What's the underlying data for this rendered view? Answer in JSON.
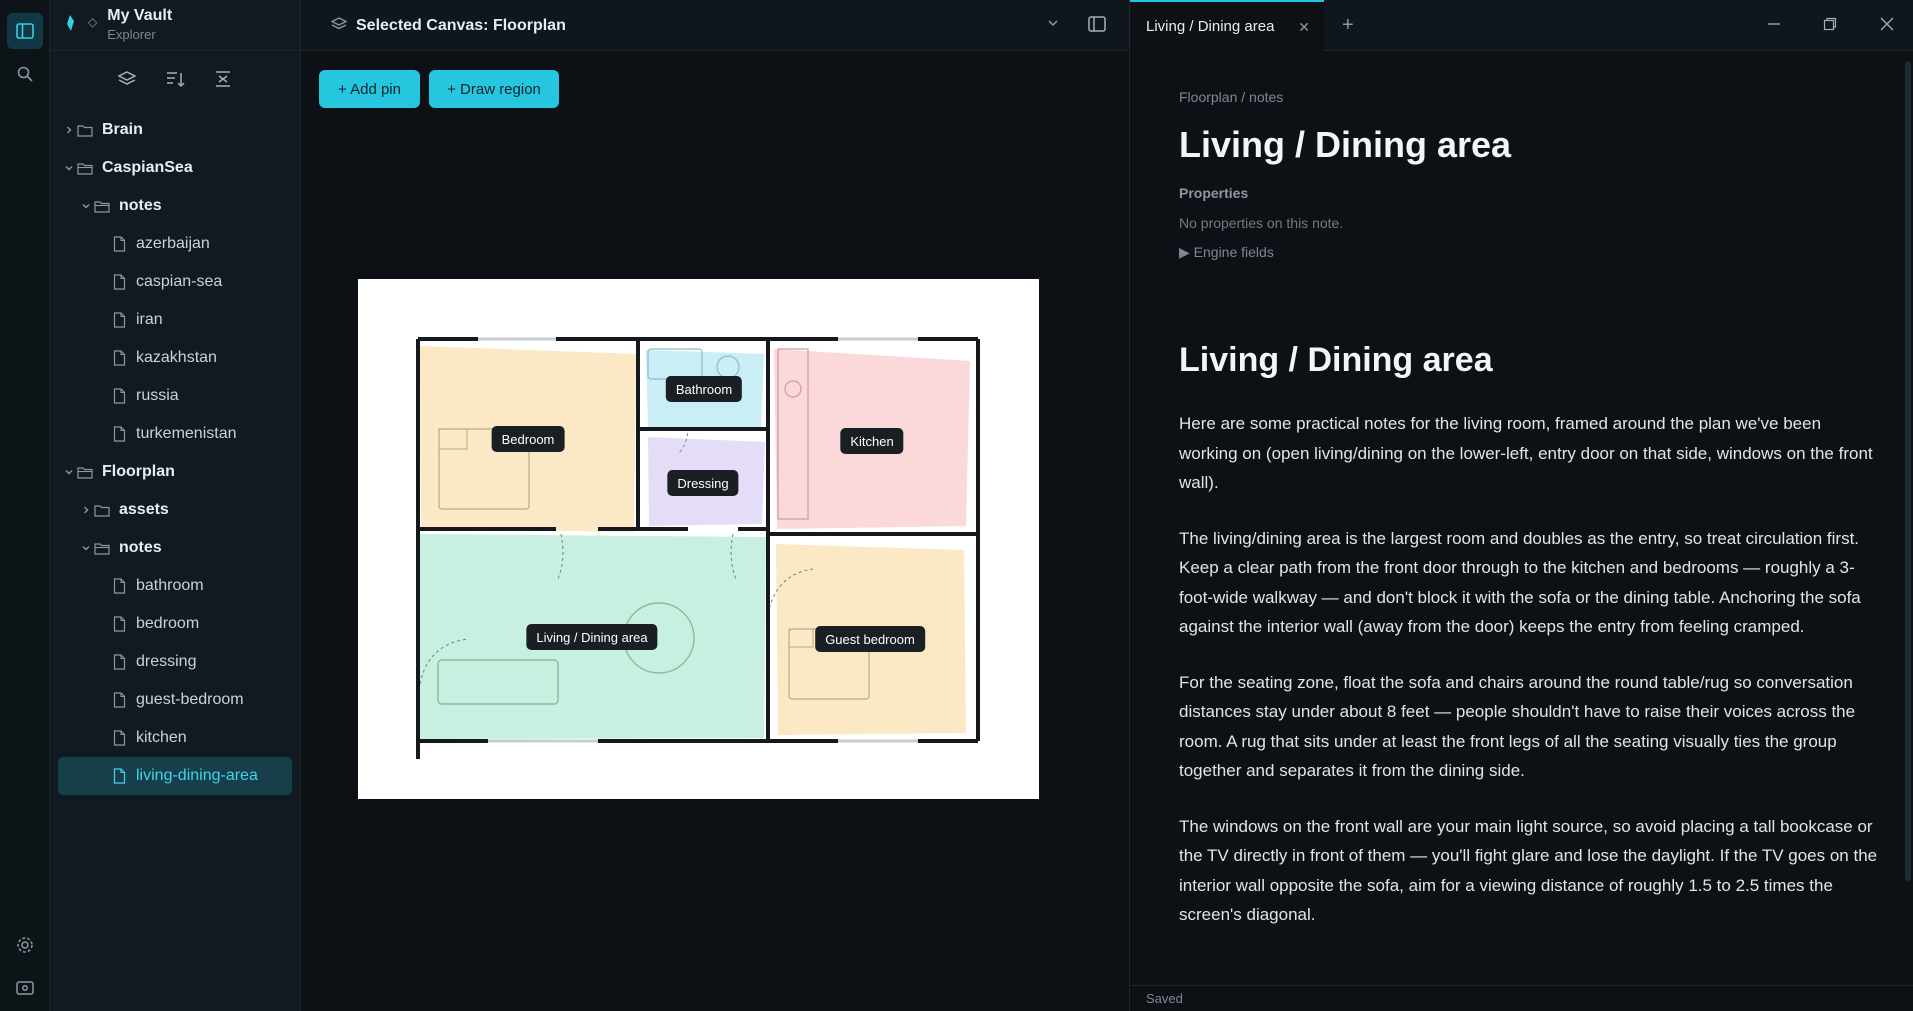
{
  "ribbon": {
    "items": [
      {
        "icon": "sidebar-toggle-icon"
      },
      {
        "icon": "search-icon"
      },
      {
        "icon": "settings-icon"
      },
      {
        "icon": "help-icon"
      }
    ]
  },
  "sidebar": {
    "vault_name": "My Vault",
    "vault_subtitle": "Explorer",
    "tools": [
      "layers-icon",
      "sort-icon",
      "collapse-all-icon"
    ],
    "tree": [
      {
        "label": "Brain",
        "type": "folder",
        "depth": 0,
        "expanded": false
      },
      {
        "label": "CaspianSea",
        "type": "folder",
        "depth": 0,
        "expanded": true
      },
      {
        "label": "notes",
        "type": "folder",
        "depth": 1,
        "expanded": true
      },
      {
        "label": "azerbaijan",
        "type": "file",
        "depth": 2
      },
      {
        "label": "caspian-sea",
        "type": "file",
        "depth": 2
      },
      {
        "label": "iran",
        "type": "file",
        "depth": 2
      },
      {
        "label": "kazakhstan",
        "type": "file",
        "depth": 2
      },
      {
        "label": "russia",
        "type": "file",
        "depth": 2
      },
      {
        "label": "turkemenistan",
        "type": "file",
        "depth": 2
      },
      {
        "label": "Floorplan",
        "type": "folder",
        "depth": 0,
        "expanded": true
      },
      {
        "label": "assets",
        "type": "folder",
        "depth": 1,
        "expanded": false
      },
      {
        "label": "notes",
        "type": "folder",
        "depth": 1,
        "expanded": true
      },
      {
        "label": "bathroom",
        "type": "file",
        "depth": 2
      },
      {
        "label": "bedroom",
        "type": "file",
        "depth": 2
      },
      {
        "label": "dressing",
        "type": "file",
        "depth": 2
      },
      {
        "label": "guest-bedroom",
        "type": "file",
        "depth": 2
      },
      {
        "label": "kitchen",
        "type": "file",
        "depth": 2
      },
      {
        "label": "living-dining-area",
        "type": "file",
        "depth": 2,
        "active": true
      }
    ]
  },
  "canvas": {
    "header_title": "Selected Canvas: Floorplan",
    "add_pin_label": "+ Add pin",
    "draw_region_label": "+ Draw region",
    "rooms": {
      "bedroom": "Bedroom",
      "bathroom": "Bathroom",
      "kitchen": "Kitchen",
      "dressing": "Dressing",
      "living": "Living / Dining area",
      "guest": "Guest bedroom"
    },
    "room_colors": {
      "bedroom": "#fbe8c4",
      "bathroom": "#c9eef6",
      "kitchen": "#fbd9da",
      "dressing": "#e5ddf7",
      "living": "#c8f0e0",
      "guest": "#fbe8c4"
    }
  },
  "tabs": {
    "active_label": "Living / Dining area"
  },
  "note": {
    "breadcrumb": "Floorplan / notes",
    "inline_title": "Living / Dining area",
    "properties_label": "Properties",
    "properties_empty": "No properties on this note.",
    "engine_fields": "▶ Engine fields",
    "heading": "Living / Dining area",
    "paragraphs": [
      "Here are some practical notes for the living room, framed around the plan we've been working on (open living/dining on the lower-left, entry door on that side, windows on the front wall).",
      "The living/dining area is the largest room and doubles as the entry, so treat circulation first. Keep a clear path from the front door through to the kitchen and bedrooms — roughly a 3-foot-wide walkway — and don't block it with the sofa or the dining table. Anchoring the sofa against the interior wall (away from the door) keeps the entry from feeling cramped.",
      "For the seating zone, float the sofa and chairs around the round table/rug so conversation distances stay under about 8 feet — people shouldn't have to raise their voices across the room. A rug that sits under at least the front legs of all the seating visually ties the group together and separates it from the dining side.",
      "The windows on the front wall are your main light source, so avoid placing a tall bookcase or the TV directly in front of them — you'll fight glare and lose the daylight. If the TV goes on the interior wall opposite the sofa, aim for a viewing distance of roughly 1.5 to 2.5 times the screen's diagonal."
    ]
  },
  "status": {
    "text": "Saved"
  },
  "colors": {
    "accent": "#26c6df",
    "active_row": "#163e4b"
  }
}
